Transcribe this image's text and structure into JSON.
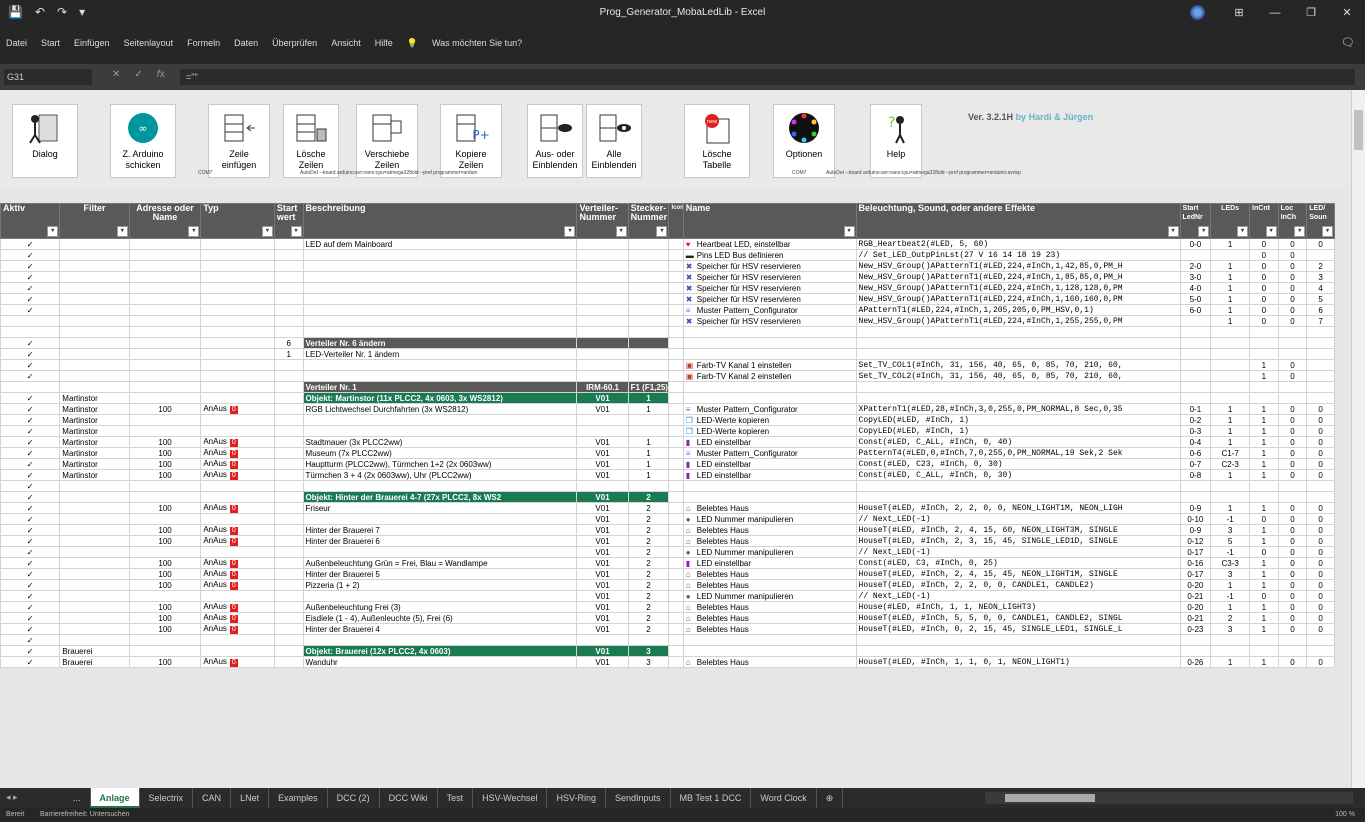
{
  "window": {
    "title": "Prog_Generator_MobaLedLib - Excel",
    "min": "—",
    "max": "❐",
    "close": "✕",
    "display": "⊞"
  },
  "menu": {
    "items": [
      "Datei",
      "Start",
      "Einfügen",
      "Seitenlayout",
      "Formeln",
      "Daten",
      "Überprüfen",
      "Ansicht",
      "Hilfe"
    ],
    "tell": "Was möchten Sie tun?"
  },
  "formula": {
    "namebox": "G31",
    "value": "=\"\""
  },
  "buttons": [
    {
      "id": "dialog",
      "label": "Dialog"
    },
    {
      "id": "arduino",
      "label": "Z. Arduino\nschicken"
    },
    {
      "id": "zeile",
      "label": "Zeile\neinfügen"
    },
    {
      "id": "loesche",
      "label": "Lösche\nZeilen"
    },
    {
      "id": "verschiebe",
      "label": "Verschiebe\nZeilen"
    },
    {
      "id": "kopiere",
      "label": "Kopiere\nZeilen"
    },
    {
      "id": "aus",
      "label": "Aus- oder\nEinblenden"
    },
    {
      "id": "alle",
      "label": "Alle\nEinblenden"
    },
    {
      "id": "tabelle",
      "label": "Lösche\nTabelle"
    },
    {
      "id": "optionen",
      "label": "Optionen"
    },
    {
      "id": "help",
      "label": "Help"
    }
  ],
  "version": "Ver. 3.2.1H",
  "by": "by Hardi & Jürgen",
  "tiny": {
    "com1": "COM7",
    "avr1": "AutoDet --board arduino:avr:nano:cpu=atmega328old --pref programmer=arduin",
    "com2": "COM7",
    "avr2": "AutoDet --board arduino:avr:nano:cpu=atmega328old --pref programmer=arduino:avrisp"
  },
  "headers": {
    "aktiv": "Aktiv",
    "filter": "Filter",
    "adresse": "Adresse oder Name",
    "typ": "Typ",
    "start": "Start wert",
    "beschreibung": "Beschreibung",
    "verteiler": "Verteiler-Nummer",
    "stecker": "Stecker-Nummer",
    "icon": "Icon",
    "name": "Name",
    "effekt": "Beleuchtung, Sound, oder andere Effekte",
    "startled": "Start LedNr",
    "leds": "LEDs",
    "inch": "InCnt",
    "loc": "Loc InCh",
    "ledsound": "LED/ Soun"
  },
  "rows": [
    {
      "a": "✓",
      "f": "",
      "ad": "",
      "t": "",
      "r": false,
      "sw": "",
      "b": "LED auf dem Mainboard",
      "v": "",
      "s": "",
      "ni": "heart",
      "n": "Heartbeat LED, einstellbar",
      "e": "RGB_Heartbeat2(#LED, 5, 60)",
      "sl": "0-0",
      "l": "1",
      "ic": "0",
      "lo": "0",
      "ls": "0",
      "k": ""
    },
    {
      "a": "✓",
      "f": "",
      "ad": "",
      "t": "",
      "r": false,
      "sw": "",
      "b": "",
      "v": "",
      "s": "",
      "ni": "bus",
      "n": "Pins LED Bus definieren",
      "e": "// Set_LED_OutpPinLst(27 V 16 14 18 19 23)",
      "sl": "",
      "l": "",
      "ic": "0",
      "lo": "0",
      "ls": "",
      "k": ""
    },
    {
      "a": "✓",
      "f": "",
      "ad": "",
      "t": "",
      "r": false,
      "sw": "",
      "b": "",
      "v": "",
      "s": "",
      "ni": "hsv",
      "n": "Speicher für HSV reservieren",
      "e": "New_HSV_Group()APatternT1(#LED,224,#InCh,1,42,85,0,PM_H",
      "sl": "2-0",
      "l": "1",
      "ic": "0",
      "lo": "0",
      "ls": "2",
      "k": ""
    },
    {
      "a": "✓",
      "f": "",
      "ad": "",
      "t": "",
      "r": false,
      "sw": "",
      "b": "",
      "v": "",
      "s": "",
      "ni": "hsv",
      "n": "Speicher für HSV reservieren",
      "e": "New_HSV_Group()APatternT1(#LED,224,#InCh,1,85,85,0,PM_H",
      "sl": "3-0",
      "l": "1",
      "ic": "0",
      "lo": "0",
      "ls": "3",
      "k": ""
    },
    {
      "a": "✓",
      "f": "",
      "ad": "",
      "t": "",
      "r": false,
      "sw": "",
      "b": "",
      "v": "",
      "s": "",
      "ni": "hsv",
      "n": "Speicher für HSV reservieren",
      "e": "New_HSV_Group()APatternT1(#LED,224,#InCh,1,128,128,0,PM",
      "sl": "4-0",
      "l": "1",
      "ic": "0",
      "lo": "0",
      "ls": "4",
      "k": ""
    },
    {
      "a": "✓",
      "f": "",
      "ad": "",
      "t": "",
      "r": false,
      "sw": "",
      "b": "",
      "v": "",
      "s": "",
      "ni": "hsv",
      "n": "Speicher für HSV reservieren",
      "e": "New_HSV_Group()APatternT1(#LED,224,#InCh,1,160,160,0,PM",
      "sl": "5-0",
      "l": "1",
      "ic": "0",
      "lo": "0",
      "ls": "5",
      "k": ""
    },
    {
      "a": "✓",
      "f": "",
      "ad": "",
      "t": "",
      "r": false,
      "sw": "",
      "b": "",
      "v": "",
      "s": "",
      "ni": "pat",
      "n": "Muster Pattern_Configurator",
      "e": "APatternT1(#LED,224,#InCh,1,205,205,0,PM_HSV,0,1)",
      "sl": "6-0",
      "l": "1",
      "ic": "0",
      "lo": "0",
      "ls": "6",
      "k": ""
    },
    {
      "a": "",
      "f": "",
      "ad": "",
      "t": "",
      "r": false,
      "sw": "",
      "b": "",
      "v": "",
      "s": "",
      "ni": "hsv",
      "n": "Speicher für HSV reservieren",
      "e": "New_HSV_Group()APatternT1(#LED,224,#InCh,1,255,255,0,PM",
      "sl": "",
      "l": "1",
      "ic": "0",
      "lo": "0",
      "ls": "7",
      "k": ""
    },
    {
      "a": "",
      "f": "",
      "ad": "",
      "t": "",
      "r": false,
      "sw": "",
      "b": "",
      "v": "",
      "s": "",
      "ni": "",
      "n": "",
      "e": "",
      "sl": "",
      "l": "",
      "ic": "",
      "lo": "",
      "ls": "",
      "k": ""
    },
    {
      "a": "✓",
      "f": "",
      "ad": "",
      "t": "",
      "r": false,
      "sw": "6",
      "b": "Verteiler Nr. 6 ändern",
      "v": "",
      "s": "",
      "ni": "",
      "n": "",
      "e": "",
      "sl": "",
      "l": "",
      "ic": "",
      "lo": "",
      "ls": "",
      "k": "sec"
    },
    {
      "a": "✓",
      "f": "",
      "ad": "",
      "t": "",
      "r": false,
      "sw": "1",
      "b": "LED-Verteiler Nr. 1 ändern",
      "v": "",
      "s": "",
      "ni": "",
      "n": "",
      "e": "",
      "sl": "",
      "l": "",
      "ic": "",
      "lo": "",
      "ls": "",
      "k": ""
    },
    {
      "a": "✓",
      "f": "",
      "ad": "",
      "t": "",
      "r": false,
      "sw": "",
      "b": "",
      "v": "",
      "s": "",
      "ni": "tv",
      "n": "Farb-TV Kanal 1 einstellen",
      "e": "Set_TV_COL1(#InCh, 31, 156, 40, 65, 0, 85, 70, 210, 60,",
      "sl": "",
      "l": "",
      "ic": "1",
      "lo": "0",
      "ls": "",
      "k": ""
    },
    {
      "a": "✓",
      "f": "",
      "ad": "",
      "t": "",
      "r": false,
      "sw": "",
      "b": "",
      "v": "",
      "s": "",
      "ni": "tv",
      "n": "Farb-TV Kanal 2 einstellen",
      "e": "Set_TV_COL2(#InCh, 31, 156, 40, 65, 0, 85, 70, 210, 60,",
      "sl": "",
      "l": "",
      "ic": "1",
      "lo": "0",
      "ls": "",
      "k": ""
    },
    {
      "a": "",
      "f": "",
      "ad": "",
      "t": "",
      "r": false,
      "sw": "",
      "b": "Verteiler Nr. 1",
      "v": "IRM-60.1",
      "s": "F1 (F1,25)",
      "ni": "",
      "n": "",
      "e": "",
      "sl": "",
      "l": "",
      "ic": "",
      "lo": "",
      "ls": "",
      "k": "sec"
    },
    {
      "a": "✓",
      "f": "Martinstor",
      "ad": "",
      "t": "",
      "r": false,
      "sw": "",
      "b": "Objekt: Martinstor (11x PLCC2, 4x 0603, 3x WS2812)",
      "v": "V01",
      "s": "1",
      "ni": "",
      "n": "",
      "e": "",
      "sl": "",
      "l": "",
      "ic": "",
      "lo": "",
      "ls": "",
      "k": "grn"
    },
    {
      "a": "✓",
      "f": "Martinstor",
      "ad": "100",
      "t": "AnAus",
      "r": true,
      "sw": "",
      "b": "RGB Lichtwechsel Durchfahrten (3x WS2812)",
      "v": "V01",
      "s": "1",
      "ni": "pat",
      "n": "Muster Pattern_Configurator",
      "e": "XPatternT1(#LED,28,#InCh,3,0,255,0,PM_NORMAL,8 Sec,0,35",
      "sl": "0-1",
      "l": "1",
      "ic": "1",
      "lo": "0",
      "ls": "0",
      "k": ""
    },
    {
      "a": "✓",
      "f": "Martinstor",
      "ad": "",
      "t": "",
      "r": false,
      "sw": "",
      "b": "",
      "v": "",
      "s": "",
      "ni": "copy",
      "n": "LED-Werte kopieren",
      "e": "CopyLED(#LED, #InCh, 1)",
      "sl": "0-2",
      "l": "1",
      "ic": "1",
      "lo": "0",
      "ls": "0",
      "k": ""
    },
    {
      "a": "✓",
      "f": "Martinstor",
      "ad": "",
      "t": "",
      "r": false,
      "sw": "",
      "b": "",
      "v": "",
      "s": "",
      "ni": "copy",
      "n": "LED-Werte kopieren",
      "e": "CopyLED(#LED, #InCh, 1)",
      "sl": "0-3",
      "l": "1",
      "ic": "1",
      "lo": "0",
      "ls": "0",
      "k": ""
    },
    {
      "a": "✓",
      "f": "Martinstor",
      "ad": "100",
      "t": "AnAus",
      "r": true,
      "sw": "",
      "b": "Stadtmauer (3x PLCC2ww)",
      "v": "V01",
      "s": "1",
      "ni": "led",
      "n": "LED einstellbar",
      "e": "Const(#LED, C_ALL, #InCh, 0, 40)",
      "sl": "0-4",
      "l": "1",
      "ic": "1",
      "lo": "0",
      "ls": "0",
      "k": ""
    },
    {
      "a": "✓",
      "f": "Martinstor",
      "ad": "100",
      "t": "AnAus",
      "r": true,
      "sw": "",
      "b": "Museum (7x PLCC2ww)",
      "v": "V01",
      "s": "1",
      "ni": "pat",
      "n": "Muster Pattern_Configurator",
      "e": "PatternT4(#LED,0,#InCh,7,0,255,0,PM_NORMAL,19 Sek,2 Sek",
      "sl": "0-6",
      "l": "C1-7",
      "ic": "1",
      "lo": "0",
      "ls": "0",
      "k": ""
    },
    {
      "a": "✓",
      "f": "Martinstor",
      "ad": "100",
      "t": "AnAus",
      "r": true,
      "sw": "",
      "b": "Hauptturm (PLCC2ww), Türmchen 1+2 (2x 0603ww)",
      "v": "V01",
      "s": "1",
      "ni": "led",
      "n": "LED einstellbar",
      "e": "Const(#LED, C23, #InCh, 0, 30)",
      "sl": "0-7",
      "l": "C2-3",
      "ic": "1",
      "lo": "0",
      "ls": "0",
      "k": ""
    },
    {
      "a": "✓",
      "f": "Martinstor",
      "ad": "100",
      "t": "AnAus",
      "r": true,
      "sw": "",
      "b": "Türmchen 3 + 4 (2x 0603ww), Uhr (PLCC2ww)",
      "v": "V01",
      "s": "1",
      "ni": "led",
      "n": "LED einstellbar",
      "e": "Const(#LED, C_ALL, #InCh, 0, 30)",
      "sl": "0-8",
      "l": "1",
      "ic": "1",
      "lo": "0",
      "ls": "0",
      "k": ""
    },
    {
      "a": "✓",
      "f": "",
      "ad": "",
      "t": "",
      "r": false,
      "sw": "",
      "b": "",
      "v": "",
      "s": "",
      "ni": "",
      "n": "",
      "e": "",
      "sl": "",
      "l": "",
      "ic": "",
      "lo": "",
      "ls": "",
      "k": ""
    },
    {
      "a": "✓",
      "f": "",
      "ad": "",
      "t": "",
      "r": false,
      "sw": "",
      "b": "Objekt: Hinter der Brauerei 4-7 (27x PLCC2, 8x WS2",
      "v": "V01",
      "s": "2",
      "ni": "",
      "n": "",
      "e": "",
      "sl": "",
      "l": "",
      "ic": "",
      "lo": "",
      "ls": "",
      "k": "grn"
    },
    {
      "a": "✓",
      "f": "",
      "ad": "100",
      "t": "AnAus",
      "r": true,
      "sw": "",
      "b": "Friseur",
      "v": "V01",
      "s": "2",
      "ni": "house",
      "n": "Belebtes Haus",
      "e": "HouseT(#LED, #InCh, 2, 2, 0, 0, NEON_LIGHT1M, NEON_LIGH",
      "sl": "0-9",
      "l": "1",
      "ic": "1",
      "lo": "0",
      "ls": "0",
      "k": ""
    },
    {
      "a": "✓",
      "f": "",
      "ad": "",
      "t": "",
      "r": false,
      "sw": "",
      "b": "",
      "v": "V01",
      "s": "2",
      "ni": "num",
      "n": "LED Nummer manipulieren",
      "e": "// Next_LED(-1)",
      "sl": "0-10",
      "l": "-1",
      "ic": "0",
      "lo": "0",
      "ls": "0",
      "k": ""
    },
    {
      "a": "✓",
      "f": "",
      "ad": "100",
      "t": "AnAus",
      "r": true,
      "sw": "",
      "b": "Hinter der Brauerei 7",
      "v": "V01",
      "s": "2",
      "ni": "house",
      "n": "Belebtes Haus",
      "e": "HouseT(#LED, #InCh, 2, 4, 15, 60, NEON_LIGHT3M, SINGLE",
      "sl": "0-9",
      "l": "3",
      "ic": "1",
      "lo": "0",
      "ls": "0",
      "k": ""
    },
    {
      "a": "✓",
      "f": "",
      "ad": "100",
      "t": "AnAus",
      "r": true,
      "sw": "",
      "b": "Hinter der Brauerei 6",
      "v": "V01",
      "s": "2",
      "ni": "house",
      "n": "Belebtes Haus",
      "e": "HouseT(#LED, #InCh, 2, 3, 15, 45, SINGLE_LED1D, SINGLE",
      "sl": "0-12",
      "l": "5",
      "ic": "1",
      "lo": "0",
      "ls": "0",
      "k": ""
    },
    {
      "a": "✓",
      "f": "",
      "ad": "",
      "t": "",
      "r": false,
      "sw": "",
      "b": "",
      "v": "V01",
      "s": "2",
      "ni": "num",
      "n": "LED Nummer manipulieren",
      "e": "// Next_LED(-1)",
      "sl": "0-17",
      "l": "-1",
      "ic": "0",
      "lo": "0",
      "ls": "0",
      "k": ""
    },
    {
      "a": "✓",
      "f": "",
      "ad": "100",
      "t": "AnAus",
      "r": true,
      "sw": "",
      "b": "Außenbeleuchtung Grün = Frei, Blau = Wandlampe",
      "v": "V01",
      "s": "2",
      "ni": "led",
      "n": "LED einstellbar",
      "e": "Const(#LED, C3, #InCh, 0, 25)",
      "sl": "0-16",
      "l": "C3-3",
      "ic": "1",
      "lo": "0",
      "ls": "0",
      "k": ""
    },
    {
      "a": "✓",
      "f": "",
      "ad": "100",
      "t": "AnAus",
      "r": true,
      "sw": "",
      "b": "Hinter der Brauerei 5",
      "v": "V01",
      "s": "2",
      "ni": "house",
      "n": "Belebtes Haus",
      "e": "HouseT(#LED, #InCh, 2, 4, 15, 45, NEON_LIGHT1M, SINGLE",
      "sl": "0-17",
      "l": "3",
      "ic": "1",
      "lo": "0",
      "ls": "0",
      "k": ""
    },
    {
      "a": "✓",
      "f": "",
      "ad": "100",
      "t": "AnAus",
      "r": true,
      "sw": "",
      "b": "Pizzeria (1 + 2)",
      "v": "V01",
      "s": "2",
      "ni": "house",
      "n": "Belebtes Haus",
      "e": "HouseT(#LED, #InCh, 2, 2, 0, 0, CANDLE1, CANDLE2)",
      "sl": "0-20",
      "l": "1",
      "ic": "1",
      "lo": "0",
      "ls": "0",
      "k": ""
    },
    {
      "a": "✓",
      "f": "",
      "ad": "",
      "t": "",
      "r": false,
      "sw": "",
      "b": "",
      "v": "V01",
      "s": "2",
      "ni": "num",
      "n": "LED Nummer manipulieren",
      "e": "// Next_LED(-1)",
      "sl": "0-21",
      "l": "-1",
      "ic": "0",
      "lo": "0",
      "ls": "0",
      "k": ""
    },
    {
      "a": "✓",
      "f": "",
      "ad": "100",
      "t": "AnAus",
      "r": true,
      "sw": "",
      "b": "Außenbeleuchtung Frei (3)",
      "v": "V01",
      "s": "2",
      "ni": "house",
      "n": "Belebtes Haus",
      "e": "House(#LED, #InCh, 1, 1, NEON_LIGHT3)",
      "sl": "0-20",
      "l": "1",
      "ic": "1",
      "lo": "0",
      "ls": "0",
      "k": ""
    },
    {
      "a": "✓",
      "f": "",
      "ad": "100",
      "t": "AnAus",
      "r": true,
      "sw": "",
      "b": "Eisdiele (1 - 4), Außenleuchte (5), Frei (6)",
      "v": "V01",
      "s": "2",
      "ni": "house",
      "n": "Belebtes Haus",
      "e": "HouseT(#LED, #InCh, 5, 5, 0, 0, CANDLE1, CANDLE2, SINGL",
      "sl": "0-21",
      "l": "2",
      "ic": "1",
      "lo": "0",
      "ls": "0",
      "k": ""
    },
    {
      "a": "✓",
      "f": "",
      "ad": "100",
      "t": "AnAus",
      "r": true,
      "sw": "",
      "b": "Hinter der Brauerei 4",
      "v": "V01",
      "s": "2",
      "ni": "house",
      "n": "Belebtes Haus",
      "e": "HouseT(#LED, #InCh, 0, 2, 15, 45, SINGLE_LED1, SINGLE_L",
      "sl": "0-23",
      "l": "3",
      "ic": "1",
      "lo": "0",
      "ls": "0",
      "k": ""
    },
    {
      "a": "✓",
      "f": "",
      "ad": "",
      "t": "",
      "r": false,
      "sw": "",
      "b": "",
      "v": "",
      "s": "",
      "ni": "",
      "n": "",
      "e": "",
      "sl": "",
      "l": "",
      "ic": "",
      "lo": "",
      "ls": "",
      "k": ""
    },
    {
      "a": "✓",
      "f": "Brauerei",
      "ad": "",
      "t": "",
      "r": false,
      "sw": "",
      "b": "Objekt: Brauerei  (12x PLCC2, 4x 0603)",
      "v": "V01",
      "s": "3",
      "ni": "",
      "n": "",
      "e": "",
      "sl": "",
      "l": "",
      "ic": "",
      "lo": "",
      "ls": "",
      "k": "grn"
    },
    {
      "a": "✓",
      "f": "Brauerei",
      "ad": "100",
      "t": "AnAus",
      "r": true,
      "sw": "",
      "b": "Wanduhr",
      "v": "V01",
      "s": "3",
      "ni": "house",
      "n": "Belebtes Haus",
      "e": "HouseT(#LED, #InCh, 1, 1, 0, 1, NEON_LIGHT1)",
      "sl": "0-26",
      "l": "1",
      "ic": "1",
      "lo": "0",
      "ls": "0",
      "k": ""
    }
  ],
  "sheets": [
    "...",
    "Anlage",
    "Selectrix",
    "CAN",
    "LNet",
    "Examples",
    "DCC (2)",
    "DCC Wiki",
    "Test",
    "HSV-Wechsel",
    "HSV-Ring",
    "SendInputs",
    "MB Test 1 DCC",
    "Word Clock"
  ],
  "activeSheet": "Anlage",
  "status": {
    "ready": "Bereit",
    "access": "Barrierefreiheit: Untersuchen",
    "zoom": "100 %"
  },
  "colors": {
    "accent": "#217346",
    "header": "#595959",
    "green": "#1a7a52",
    "red": "#e0201f"
  }
}
